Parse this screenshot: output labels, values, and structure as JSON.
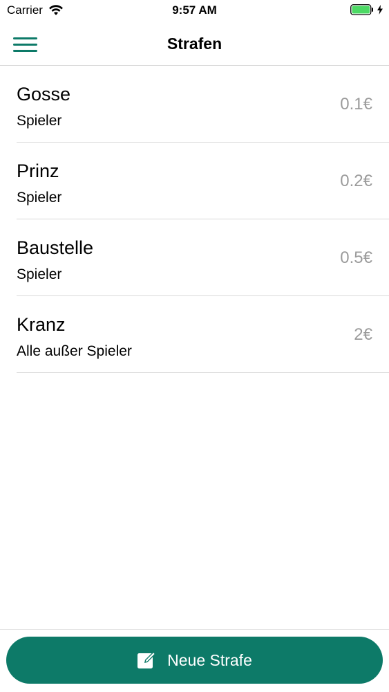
{
  "status_bar": {
    "carrier": "Carrier",
    "time": "9:57 AM",
    "icons": [
      "wifi-icon",
      "battery-icon",
      "charging-bolt-icon"
    ]
  },
  "nav": {
    "title": "Strafen",
    "menu_icon": "hamburger-menu-icon"
  },
  "penalties": [
    {
      "name": "Gosse",
      "target": "Spieler",
      "amount": "0.1€"
    },
    {
      "name": "Prinz",
      "target": "Spieler",
      "amount": "0.2€"
    },
    {
      "name": "Baustelle",
      "target": "Spieler",
      "amount": "0.5€"
    },
    {
      "name": "Kranz",
      "target": "Alle außer Spieler",
      "amount": "2€"
    }
  ],
  "actions": {
    "new_penalty_label": "Neue Strafe",
    "new_penalty_icon": "edit-icon"
  },
  "colors": {
    "accent": "#0d7a68",
    "amount_text": "#9b9b9b",
    "battery": "#4cd964"
  }
}
